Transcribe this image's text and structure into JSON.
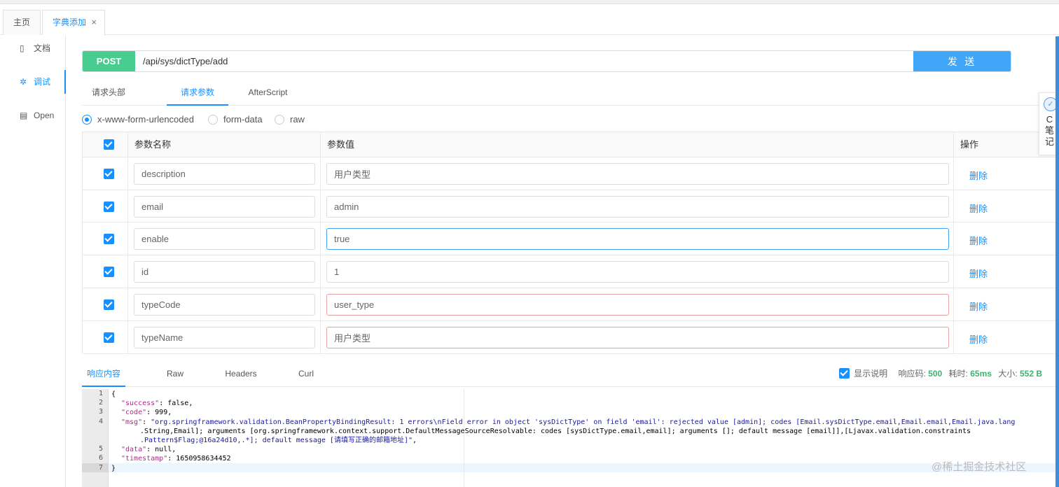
{
  "tabs": {
    "home": "主页",
    "active": "字典添加",
    "close": "×"
  },
  "sidebar": {
    "items": [
      {
        "label": "文档",
        "icon": "document-icon"
      },
      {
        "label": "调试",
        "icon": "bug-icon"
      },
      {
        "label": "Open",
        "icon": "file-icon"
      }
    ]
  },
  "request": {
    "method": "POST",
    "url": "/api/sys/dictType/add",
    "send": "发 送",
    "method_color": "#49cc90",
    "send_color": "#41a6f7"
  },
  "req_tabs": [
    "请求头部",
    "请求参数",
    "AfterScript"
  ],
  "body_types": [
    "x-www-form-urlencoded",
    "form-data",
    "raw"
  ],
  "params": {
    "headers": {
      "name": "参数名称",
      "value": "参数值",
      "action": "操作"
    },
    "rows": [
      {
        "name": "description",
        "value": "用户类型",
        "action": "删除"
      },
      {
        "name": "email",
        "value": "admin",
        "action": "删除"
      },
      {
        "name": "enable",
        "value": "true",
        "action": "删除"
      },
      {
        "name": "id",
        "value": "1",
        "action": "删除"
      },
      {
        "name": "typeCode",
        "value": "user_type",
        "action": "删除"
      },
      {
        "name": "typeName",
        "value": "用户类型",
        "action": "删除"
      }
    ]
  },
  "resp_tabs": [
    "响应内容",
    "Raw",
    "Headers",
    "Curl"
  ],
  "resp_meta": {
    "show_desc": "显示说明",
    "code_label": "响应码:",
    "code": "500",
    "time_label": "耗时:",
    "time": "65ms",
    "size_label": "大小:",
    "size": "552 B"
  },
  "code_lines": {
    "n": [
      "1",
      "2",
      "3",
      "4",
      "",
      "",
      "5",
      "6",
      "7"
    ],
    "l1": "{",
    "l2_key": "\"success\"",
    "l2_val": ": false,",
    "l3_key": "\"code\"",
    "l3_val": ": 999,",
    "l4_key": "\"msg\"",
    "l4_a": "\"org.springframework.validation.BeanPropertyBindingResult: 1 errors\\nField error in object 'sysDictType' on field 'email': rejected value [admin]; codes [Email.sysDictType.email,Email.email,Email.java.lang",
    "l4_b": ".String,Email]; arguments [org.springframework.context.support.DefaultMessageSourceResolvable: codes [sysDictType.email,email]; arguments []; default message [email]],[Ljavax.validation.constraints",
    "l4_c": ".Pattern$Flag;@16a24d10,.*]; default message [请填写正确的邮箱地址]\"",
    "l4_end": ",",
    "l5_key": "\"data\"",
    "l5_val": ": null,",
    "l6_key": "\"timestamp\"",
    "l6_val": ": 1650958634452",
    "l7": "}"
  },
  "float_widget": {
    "icon": "✓",
    "line1": "C",
    "line2": "笔",
    "line3": "记"
  },
  "watermark": "@稀土掘金技术社区"
}
